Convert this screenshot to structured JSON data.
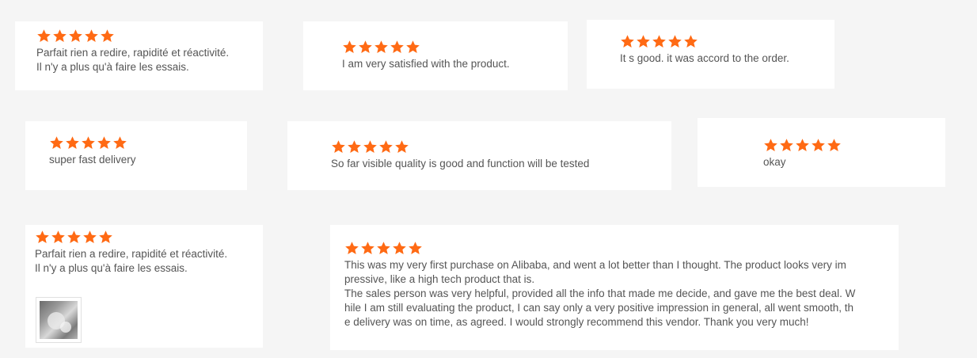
{
  "colors": {
    "page_background": "#f5f5f5",
    "card_background": "#ffffff",
    "star": "#ff6a14",
    "text": "#555555"
  },
  "reviews": [
    {
      "rating": 5,
      "text": "Parfait rien a redire, rapidité et réactivité.\nIl n'y a plus qu'à faire les essais."
    },
    {
      "rating": 5,
      "text": "I am very satisfied with the product."
    },
    {
      "rating": 5,
      "text": "It s good. it was accord to the order."
    },
    {
      "rating": 5,
      "text": "super fast delivery"
    },
    {
      "rating": 5,
      "text": "So far visible quality is good and function will be tested"
    },
    {
      "rating": 5,
      "text": "okay"
    },
    {
      "rating": 5,
      "text": "Parfait rien a redire, rapidité et réactivité.\nIl n'y a plus qu'à faire les essais.",
      "has_photo": true
    },
    {
      "rating": 5,
      "text": "This was my very first purchase on Alibaba, and went a lot better than I thought. The product looks very im\npressive, like a high tech product that is.\nThe sales person was very helpful, provided all the info that made me decide, and gave me the best deal. W\nhile I am still evaluating the product, I can say only a very positive impression in general, all went smooth, th\ne delivery was on time, as agreed. I would strongly recommend this vendor. Thank you very much!"
    }
  ]
}
